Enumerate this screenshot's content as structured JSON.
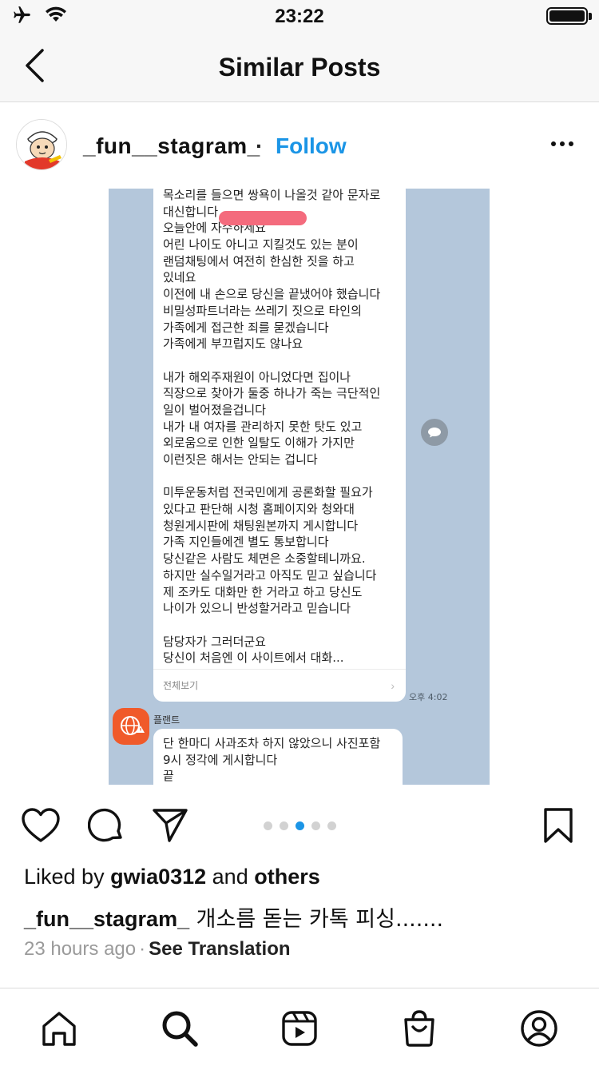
{
  "status_bar": {
    "time": "23:22"
  },
  "nav": {
    "title": "Similar Posts"
  },
  "post": {
    "username": "_fun__stagram_",
    "separator": "·",
    "follow_label": "Follow",
    "image": {
      "message_lines": [
        "목소리를 들으면 쌍욕이 나올것 같아 문자로",
        "대신합니다",
        "오늘안에                         자수하세요",
        "어린 나이도 아니고 지킬것도 있는 분이",
        "랜덤채팅에서 여전히 한심한 짓을 하고",
        "있네요",
        "이전에 내 손으로 당신을 끝냈어야 했습니다",
        "비밀성파트너라는 쓰레기 짓으로 타인의",
        "가족에게 접근한 죄를 묻겠습니다",
        "가족에게 부끄럽지도 않나요",
        "",
        "내가 해외주재원이 아니었다면 집이나",
        "직장으로 찾아가 둘중 하나가 죽는 극단적인",
        "일이 벌어졌을겁니다",
        "내가 내 여자를 관리하지 못한 탓도 있고",
        "외로움으로 인한 일탈도 이해가 가지만",
        "이런짓은 해서는 안되는 겁니다",
        "",
        "미투운동처럼 전국민에게 공론화할 필요가",
        "있다고 판단해  시청 홈페이지와 청와대",
        "청원게시판에 채팅원본까지 게시합니다",
        "가족 지인들에겐 별도 통보합니다",
        "당신같은 사람도 체면은 소중할테니까요.",
        "하지만 실수일거라고 아직도 믿고 싶습니다",
        "제 조카도 대화만 한 거라고 하고 당신도",
        "나이가 있으니 반성할거라고 믿습니다",
        "",
        "담당자가 그러더군요",
        "당신이 처음엔 이 사이트에서 대화..."
      ],
      "view_all": "전체보기",
      "time": "오후 4:02",
      "sender_name": "플랜트",
      "reply_lines": [
        "단 한마디 사과조차 하지 않았으니 사진포함",
        "9시 정각에 게시합니다",
        "끝"
      ]
    },
    "carousel": {
      "count": 5,
      "active_index": 2
    },
    "liked_prefix": "Liked by ",
    "liked_user": "gwia0312",
    "liked_middle": " and ",
    "liked_suffix": "others",
    "caption_user": "_fun__stagram_",
    "caption_text": " 개소름 돋는 카톡 피싱.......",
    "time_ago": "23 hours ago",
    "meta_sep": "·",
    "see_translation": "See Translation"
  },
  "icons": {
    "back": "chevron-left-icon",
    "more": "ellipsis-icon",
    "like": "heart-icon",
    "comment": "comment-icon",
    "share": "send-icon",
    "save": "bookmark-icon",
    "tabs": [
      "home-icon",
      "search-icon",
      "reels-icon",
      "shop-icon",
      "profile-icon"
    ]
  },
  "colors": {
    "accent": "#1b95e6",
    "chat_bg": "#b4c7db",
    "redaction": "#f46b7d"
  }
}
